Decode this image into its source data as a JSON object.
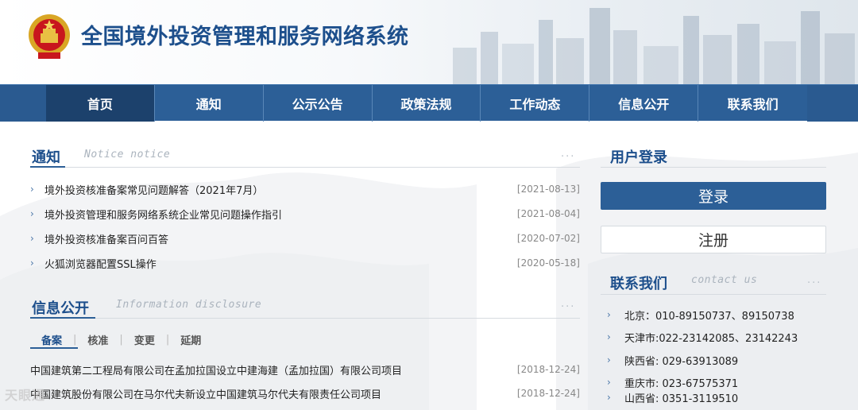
{
  "header": {
    "site_title": "全国境外投资管理和服务网络系统"
  },
  "nav": {
    "items": [
      {
        "label": "首页",
        "active": true
      },
      {
        "label": "通知",
        "active": false
      },
      {
        "label": "公示公告",
        "active": false
      },
      {
        "label": "政策法规",
        "active": false
      },
      {
        "label": "工作动态",
        "active": false
      },
      {
        "label": "信息公开",
        "active": false
      },
      {
        "label": "联系我们",
        "active": false
      }
    ]
  },
  "notice": {
    "title": "通知",
    "subtitle": "Notice notice",
    "more": "...",
    "items": [
      {
        "text": "境外投资核准备案常见问题解答（2021年7月）",
        "date": "[2021-08-13]"
      },
      {
        "text": "境外投资管理和服务网络系统企业常见问题操作指引",
        "date": "[2021-08-04]"
      },
      {
        "text": "境外投资核准备案百问百答",
        "date": "[2020-07-02]"
      },
      {
        "text": "火狐浏览器配置SSL操作",
        "date": "[2020-05-18]"
      }
    ]
  },
  "disclosure": {
    "title": "信息公开",
    "subtitle": "Information disclosure",
    "more": "...",
    "tabs": [
      {
        "label": "备案",
        "active": true
      },
      {
        "label": "核准",
        "active": false
      },
      {
        "label": "变更",
        "active": false
      },
      {
        "label": "延期",
        "active": false
      }
    ],
    "tab_separator": "|",
    "items": [
      {
        "text": "中国建筑第二工程局有限公司在孟加拉国设立中建海建（孟加拉国）有限公司项目",
        "date": "[2018-12-24]"
      },
      {
        "text": "中国建筑股份有限公司在马尔代夫新设立中国建筑马尔代夫有限责任公司项目",
        "date": "[2018-12-24]"
      }
    ]
  },
  "login": {
    "title": "用户登录",
    "login_label": "登录",
    "register_label": "注册"
  },
  "contact": {
    "title": "联系我们",
    "subtitle": "contact us",
    "more": "...",
    "items": [
      {
        "text": "北京：010-89150737、89150738"
      },
      {
        "text": "天津市:022-23142085、23142243"
      },
      {
        "text": "陕西省: 029-63913089"
      },
      {
        "text": "重庆市: 023-67575371"
      },
      {
        "text": "山西省: 0351-3119510"
      }
    ]
  },
  "watermark": {
    "text": "天眼通"
  },
  "colors": {
    "brand": "#2c5f97",
    "title": "#1d4f8c",
    "nav_active": "#1c416c"
  },
  "icons": {
    "list_bullet": "chevron-right-icon",
    "emblem": "national-emblem-icon"
  }
}
